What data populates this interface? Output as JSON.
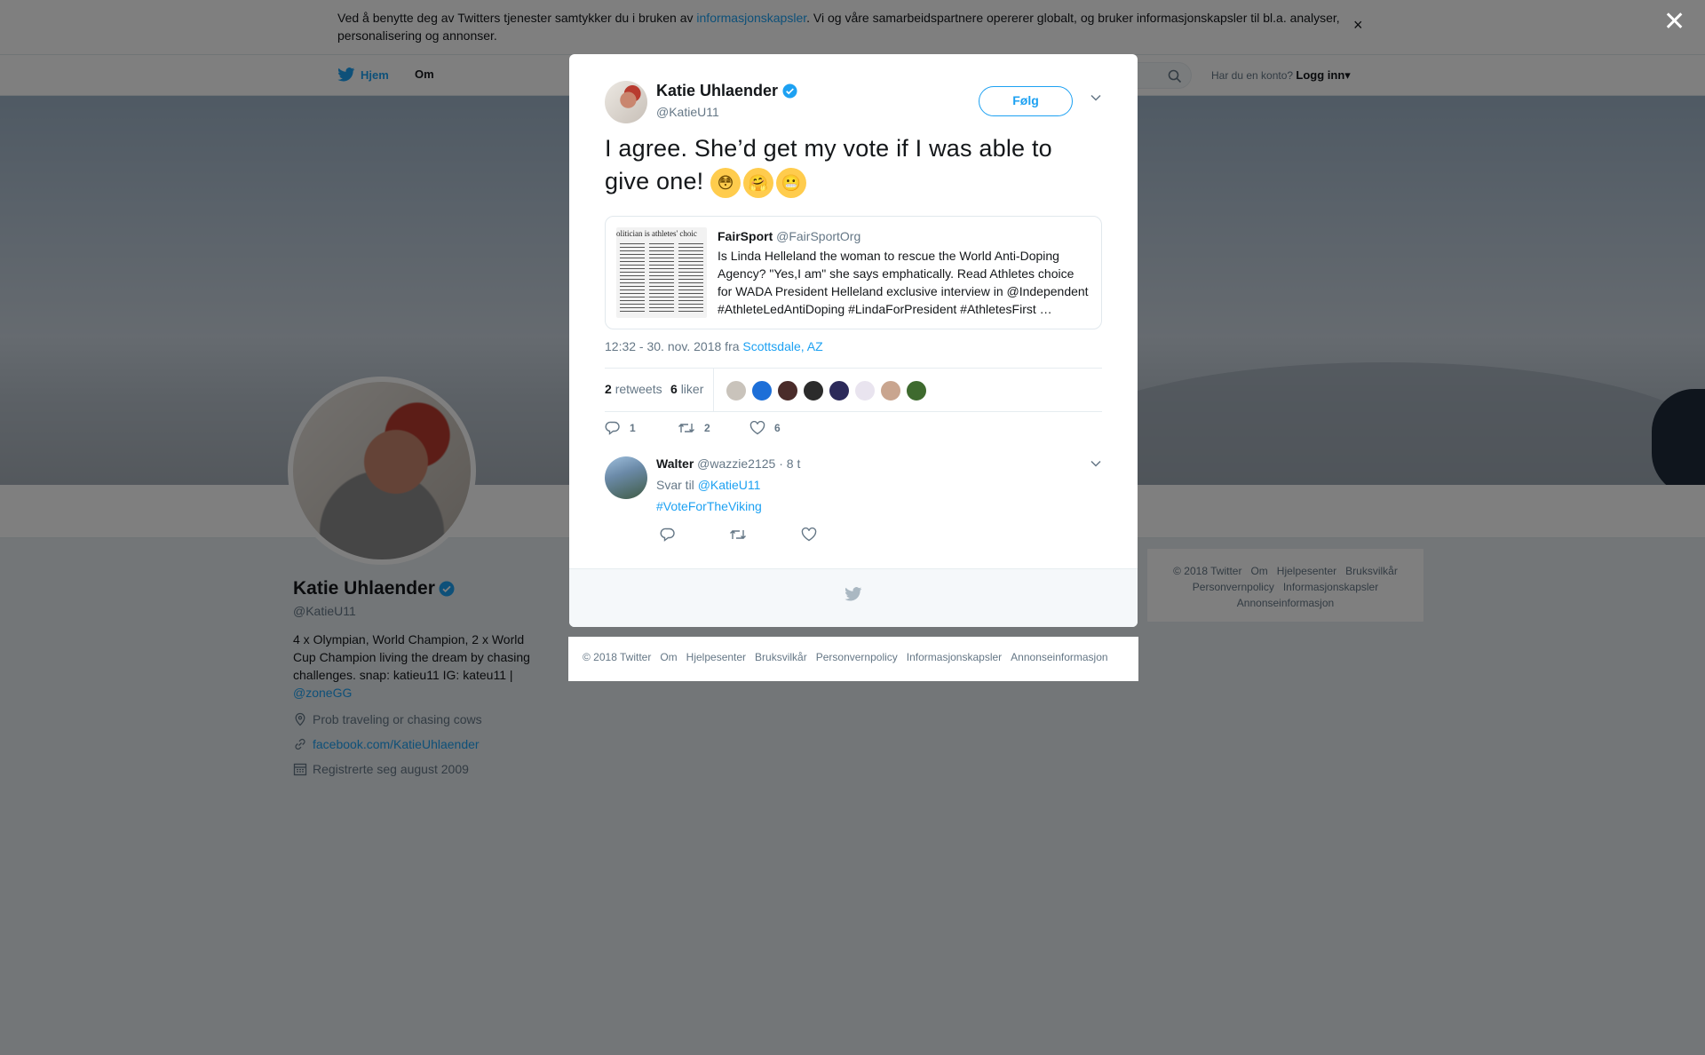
{
  "cookie": {
    "text_before": "Ved å benytte deg av Twitters tjenester samtykker du i bruken av ",
    "link": "informasjonskapsler",
    "text_after": ". Vi og våre samarbeidspartnere opererer globalt, og bruker informasjonskapsler til bl.a. analyser, personalisering og annonser.",
    "close": "×"
  },
  "nav": {
    "home": "Hjem",
    "about": "Om",
    "login_prompt": "Har du en konto?",
    "login": "Logg inn",
    "caret": "▾"
  },
  "profile": {
    "name": "Katie Uhlaender",
    "handle": "@KatieU11",
    "bio": "4 x Olympian, World Champion, 2 x World Cup Champion living the dream by chasing challenges. snap: katieu11 IG: kateu11 |",
    "bio_link": "@zoneGG",
    "location": "Prob traveling or chasing cows",
    "website": "facebook.com/KatieUhlaender",
    "joined": "Registrerte seg august 2009"
  },
  "side_footer": {
    "links": [
      "© 2018 Twitter",
      "Om",
      "Hjelpesenter",
      "Bruksvilkår",
      "Personvernpolicy",
      "Informasjonskapsler",
      "Annonseinformasjon"
    ]
  },
  "overlay": {
    "close": "✕"
  },
  "modal": {
    "author_name": "Katie Uhlaender",
    "author_handle": "@KatieU11",
    "follow_label": "Følg",
    "tweet_text": "I agree. She’d get my vote if I was able to give one!",
    "emojis": [
      "😳",
      "🤗",
      "😬"
    ],
    "quote": {
      "name": "FairSport",
      "handle": "@FairSportOrg",
      "body": "Is Linda Helleland the woman to rescue the World Anti-Doping Agency? \"Yes,I am\" she says emphatically. Read Athletes choice for WADA President Helleland exclusive interview in @Independent #AthleteLedAntiDoping #LindaForPresident #AthletesFirst …",
      "image_headline": "olitician is athletes' choic"
    },
    "timestamp": "12:32 - 30. nov. 2018 fra",
    "location": "Scottsdale, AZ",
    "retweets_count": "2",
    "retweets_label": "retweets",
    "likes_count": "6",
    "likes_label": "liker",
    "liker_avatar_colors": [
      "#c9c3bb",
      "#1d6fd8",
      "#4a2c2a",
      "#2b2b2b",
      "#2c2a5a",
      "#e9e4ef",
      "#c9a58f",
      "#3e6a2e"
    ],
    "actions": {
      "replies": "1",
      "retweets": "2",
      "likes": "6"
    },
    "reply": {
      "name": "Walter",
      "handle": "@wazzie2125",
      "time": "· 8 t",
      "reply_to_label": "Svar til",
      "reply_to": "@KatieU11",
      "hashtag": "#VoteForTheViking"
    }
  },
  "bottom_footer": {
    "links": [
      "© 2018 Twitter",
      "Om",
      "Hjelpesenter",
      "Bruksvilkår",
      "Personvernpolicy",
      "Informasjonskapsler",
      "Annonseinformasjon"
    ]
  },
  "colors": {
    "accent": "#1da1f2",
    "text": "#14171a",
    "muted": "#657786",
    "overlay": "rgba(0,0,0,0.5)"
  }
}
